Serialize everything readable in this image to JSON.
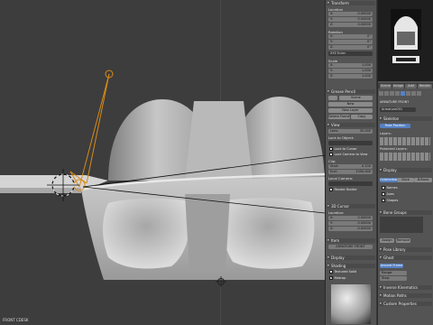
{
  "viewport": {
    "label": "FRONT CDESK"
  },
  "npanel": {
    "transform": "Transform",
    "location": "Location",
    "location_vals": [
      {
        "k": "X:",
        "v": "0.00000"
      },
      {
        "k": "Y:",
        "v": "0.00000"
      },
      {
        "k": "Z:",
        "v": "0.00000"
      }
    ],
    "rotation": "Rotation",
    "rotation_vals": [
      {
        "k": "X:",
        "v": "0°"
      },
      {
        "k": "Y:",
        "v": "0°"
      },
      {
        "k": "Z:",
        "v": "0°"
      }
    ],
    "rot_mode": "XYZ Euler",
    "scale": "Scale",
    "scale_vals": [
      {
        "k": "X:",
        "v": "1.000"
      },
      {
        "k": "Y:",
        "v": "1.000"
      },
      {
        "k": "Z:",
        "v": "1.000"
      }
    ],
    "grease": "Grease Pencil",
    "grease_btn": "Scene",
    "new": "New",
    "new_layer": "New Layer",
    "delete_frame": "Delete Frame",
    "copy": "Copy",
    "view": "View",
    "lens": "Lens:",
    "lens_val": "35.000",
    "lock_to_object": "Lock to Object:",
    "lock_to_cursor": "Lock to Cursor",
    "lock_camera": "Lock Camera to View",
    "clip": "Clip:",
    "clip_start": "Start:",
    "clip_start_val": "0.100",
    "clip_end": "End:",
    "clip_end_val": "1000.000",
    "local_camera": "Local Camera:",
    "render_border": "Render Border",
    "cursor": "3D Cursor",
    "cursor_location": "Location:",
    "cursor_vals": [
      {
        "k": "X:",
        "v": "0.00000"
      },
      {
        "k": "Y:",
        "v": "0.00000"
      },
      {
        "k": "Z:",
        "v": "0.00000"
      }
    ],
    "item": "Item",
    "item_name": "ARMATURE FRONT",
    "display": "Display",
    "shading": "Shading",
    "textured_solid": "Textured Solid",
    "matcap": "Matcap"
  },
  "props": {
    "tabs": [
      "Scene",
      "Image",
      "Add",
      "Render"
    ],
    "armature_label": "ARMATURE FRONT",
    "armature_name": "Armature001",
    "skeleton": "Skeleton",
    "pose_position": "Pose Position",
    "layers": "Layers:",
    "protected_layers": "Protected Layers:",
    "display": "Display",
    "display_modes": [
      "Octahedral",
      "Stick",
      "B-Bone"
    ],
    "names": "Names",
    "axes": "Axes",
    "shapes": "Shapes",
    "bone_groups": "Bone Groups",
    "assign": "Assign",
    "remove": "Remove",
    "pose_library": "Pose Library",
    "ghost": "Ghost",
    "around_frame": "Around Frame",
    "range": "Range:",
    "step": "Step:",
    "inverse_kinematics": "Inverse Kinematics",
    "motion_paths": "Motion Paths",
    "custom_properties": "Custom Properties"
  }
}
